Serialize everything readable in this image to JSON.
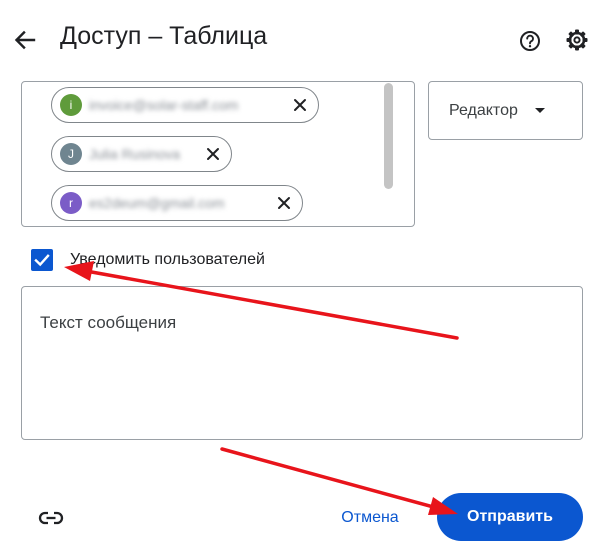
{
  "header": {
    "title": "Доступ – Таблица",
    "back_icon": "arrow-back-icon",
    "help_icon": "help-icon",
    "settings_icon": "gear-icon"
  },
  "recipients": [
    {
      "initial": "i",
      "email": "invoice@solar-staff.com",
      "color": "#5f9b3b"
    },
    {
      "initial": "J",
      "email": "Julia Rusinova",
      "color": "#6f8590"
    },
    {
      "initial": "r",
      "email": "es2deum@gmail.com",
      "color": "#7b5cc7"
    }
  ],
  "role": {
    "selected": "Редактор"
  },
  "notify": {
    "label": "Уведомить пользователей",
    "checked": true
  },
  "message": {
    "placeholder": "Текст сообщения"
  },
  "footer": {
    "link_icon": "link-icon",
    "cancel_label": "Отмена",
    "send_label": "Отправить"
  },
  "colors": {
    "accent": "#0b57d0",
    "annotation_arrow": "#e8141b"
  }
}
